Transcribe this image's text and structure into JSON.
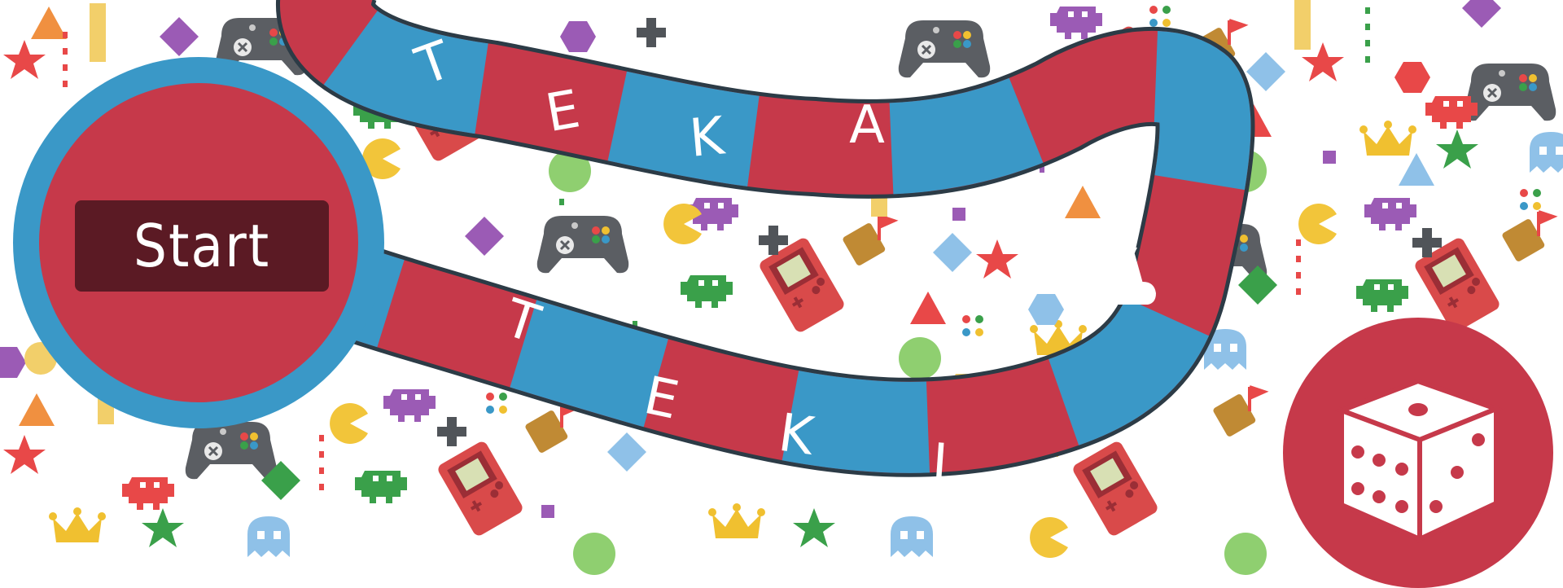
{
  "start_button": {
    "label": "Start"
  },
  "board": {
    "track_top_letters": [
      "T",
      "E",
      "K",
      "A"
    ],
    "track_bottom_letters": [
      "T",
      "E",
      "K",
      "I"
    ]
  },
  "colors": {
    "track_red": "#c6394a",
    "track_blue": "#3a98c7",
    "button_dark": "#5b1a24",
    "white": "#ffffff"
  },
  "icons": [
    "game-controller-icon",
    "space-invader-icon",
    "pacman-icon",
    "ghost-icon",
    "handheld-console-icon",
    "crown-icon",
    "star-icon",
    "hexagon-icon",
    "diamond-icon",
    "triangle-icon",
    "flag-icon",
    "dpad-icon",
    "pawn-icon",
    "dice-icon"
  ]
}
